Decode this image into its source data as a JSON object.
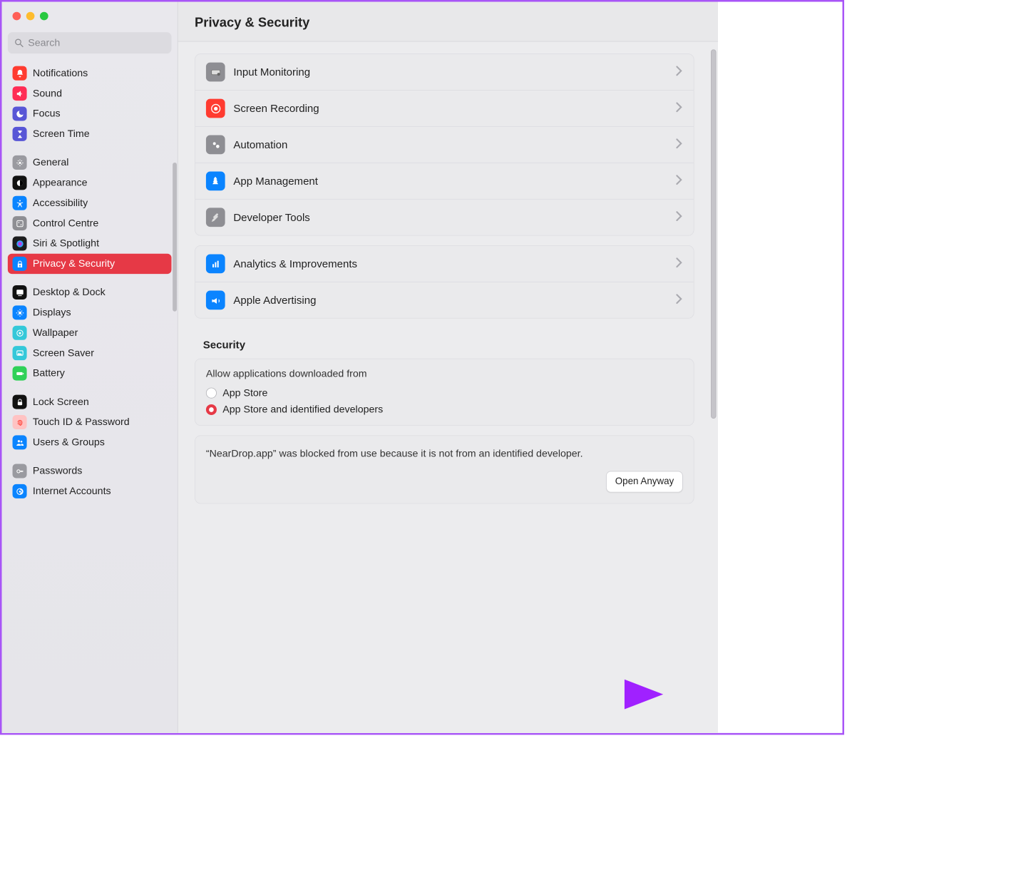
{
  "header": {
    "title": "Privacy & Security"
  },
  "search": {
    "placeholder": "Search"
  },
  "sidebar": {
    "groups": [
      {
        "items": [
          {
            "key": "notifications",
            "label": "Notifications",
            "iconBg": "#ff3b30"
          },
          {
            "key": "sound",
            "label": "Sound",
            "iconBg": "#ff2d55"
          },
          {
            "key": "focus",
            "label": "Focus",
            "iconBg": "#5856d6"
          },
          {
            "key": "screen-time",
            "label": "Screen Time",
            "iconBg": "#5856d6"
          }
        ]
      },
      {
        "items": [
          {
            "key": "general",
            "label": "General",
            "iconBg": "#9a9aa0"
          },
          {
            "key": "appearance",
            "label": "Appearance",
            "iconBg": "#111"
          },
          {
            "key": "accessibility",
            "label": "Accessibility",
            "iconBg": "#0a84ff"
          },
          {
            "key": "control-centre",
            "label": "Control Centre",
            "iconBg": "#8e8e93"
          },
          {
            "key": "siri",
            "label": "Siri & Spotlight",
            "iconBg": "#1c1c1e"
          },
          {
            "key": "privacy",
            "label": "Privacy & Security",
            "iconBg": "#0a84ff",
            "selected": true
          }
        ]
      },
      {
        "items": [
          {
            "key": "desktop-dock",
            "label": "Desktop & Dock",
            "iconBg": "#111"
          },
          {
            "key": "displays",
            "label": "Displays",
            "iconBg": "#0a84ff"
          },
          {
            "key": "wallpaper",
            "label": "Wallpaper",
            "iconBg": "#34c8d9"
          },
          {
            "key": "screen-saver",
            "label": "Screen Saver",
            "iconBg": "#34c8d9"
          },
          {
            "key": "battery",
            "label": "Battery",
            "iconBg": "#30d158"
          }
        ]
      },
      {
        "items": [
          {
            "key": "lock-screen",
            "label": "Lock Screen",
            "iconBg": "#111"
          },
          {
            "key": "touch-id",
            "label": "Touch ID & Password",
            "iconBg": "#ffc3c3"
          },
          {
            "key": "users-groups",
            "label": "Users & Groups",
            "iconBg": "#0a84ff"
          }
        ]
      },
      {
        "items": [
          {
            "key": "passwords",
            "label": "Passwords",
            "iconBg": "#9a9aa0"
          },
          {
            "key": "internet-accounts",
            "label": "Internet Accounts",
            "iconBg": "#0a84ff"
          }
        ]
      }
    ]
  },
  "main": {
    "rows1": [
      {
        "key": "input-monitoring",
        "label": "Input Monitoring",
        "iconBg": "#8e8e93"
      },
      {
        "key": "screen-recording",
        "label": "Screen Recording",
        "iconBg": "#ff3b30"
      },
      {
        "key": "automation",
        "label": "Automation",
        "iconBg": "#8e8e93"
      },
      {
        "key": "app-management",
        "label": "App Management",
        "iconBg": "#0a84ff"
      },
      {
        "key": "developer-tools",
        "label": "Developer Tools",
        "iconBg": "#8e8e93"
      }
    ],
    "rows2": [
      {
        "key": "analytics",
        "label": "Analytics & Improvements",
        "iconBg": "#0a84ff"
      },
      {
        "key": "apple-ads",
        "label": "Apple Advertising",
        "iconBg": "#0a84ff"
      }
    ],
    "securityTitle": "Security",
    "allowTitle": "Allow applications downloaded from",
    "allowOptions": [
      {
        "key": "app-store",
        "label": "App Store",
        "checked": false
      },
      {
        "key": "identified",
        "label": "App Store and identified developers",
        "checked": true
      }
    ],
    "blockedMsg": "“NearDrop.app” was blocked from use because it is not from an identified developer.",
    "openAnyway": "Open Anyway"
  }
}
